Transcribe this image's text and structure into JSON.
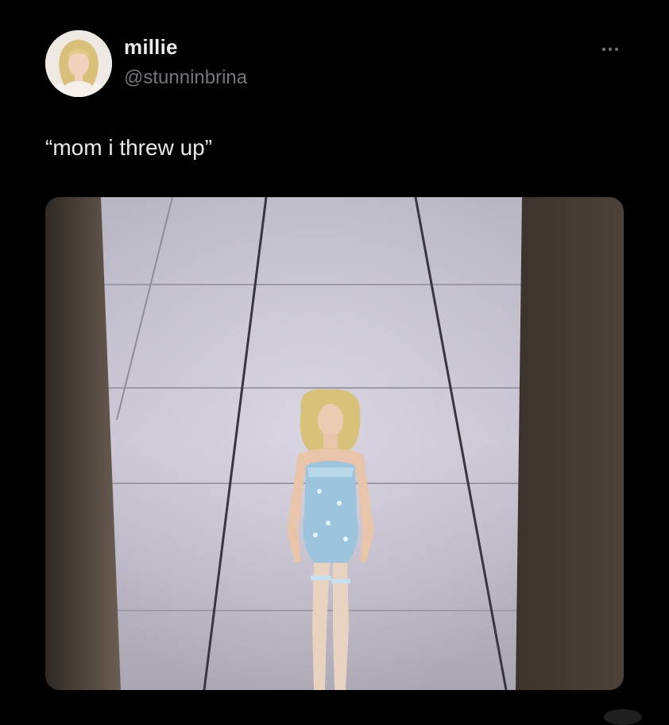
{
  "tweet": {
    "author": {
      "display_name": "millie",
      "handle": "@stunninbrina",
      "avatar_icon": "profile-avatar"
    },
    "text": "“mom i threw up”",
    "more_icon": "ellipsis-icon",
    "media": {
      "type": "photo",
      "icon": "photo-runway-performer"
    }
  },
  "colors": {
    "background": "#000000",
    "text_primary": "#e7e9ea",
    "text_secondary": "#71767b"
  }
}
